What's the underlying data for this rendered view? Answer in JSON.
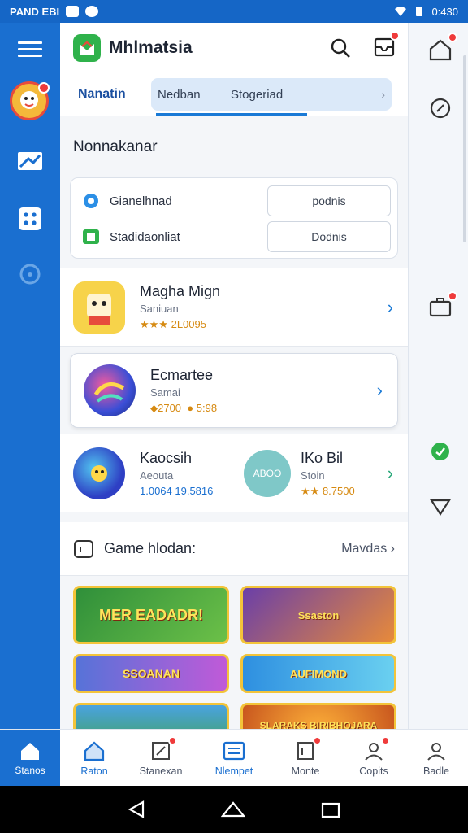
{
  "status_bar": {
    "left_text": "PAND EBI",
    "time": "0:430"
  },
  "header": {
    "app_title": "Mhlmatsia"
  },
  "tabs": {
    "active": "Nanatin",
    "items": [
      "Nedban",
      "Stogeriad"
    ]
  },
  "section": {
    "title": "Nonnakanar"
  },
  "quick_actions": [
    {
      "label": "Gianelhnad",
      "button": "podnis",
      "icon": "blue-gear-icon"
    },
    {
      "label": "Stadidaonliat",
      "button": "Dodnis",
      "icon": "green-box-icon"
    }
  ],
  "games": [
    {
      "name": "Magha Mign",
      "subtitle": "Saniuan",
      "meta": "2L0095",
      "stars": "★★★"
    },
    {
      "name": "Ecmartee",
      "subtitle": "Samai",
      "meta_a": "2700",
      "meta_b": "5:98"
    },
    {
      "name": "Kaocsih",
      "subtitle": "Aeouta",
      "meta": "1.0064 19.5816",
      "name2": "IKo Bil",
      "subtitle2": "Stoin",
      "meta2": "8.7500",
      "bubble": "ABOO"
    }
  ],
  "hub": {
    "title": "Game hlodan:",
    "action": "Mavdas"
  },
  "banners": [
    {
      "text": "MER EADADR!",
      "bg": "#2f8f3a"
    },
    {
      "text": "Ssaston",
      "bg": "#6a3fa8"
    },
    {
      "text": "SSOANAN",
      "bg": "#5673d8"
    },
    {
      "text": "AUFIMOND",
      "bg": "#2e8fe0"
    },
    {
      "text": "",
      "bg": "#4aa3e0"
    },
    {
      "text": "SLARAKS BIRIBHOJARA DANIAN",
      "bg": "#c8561e"
    }
  ],
  "bottom_nav": {
    "home": "Stanos",
    "items": [
      "Raton",
      "Stanexan",
      "Nlempet",
      "Monte",
      "Copits",
      "Badle"
    ]
  },
  "colors": {
    "accent": "#1a6fd0",
    "badge": "#ef3b3b",
    "brand_green": "#2fb24b"
  }
}
